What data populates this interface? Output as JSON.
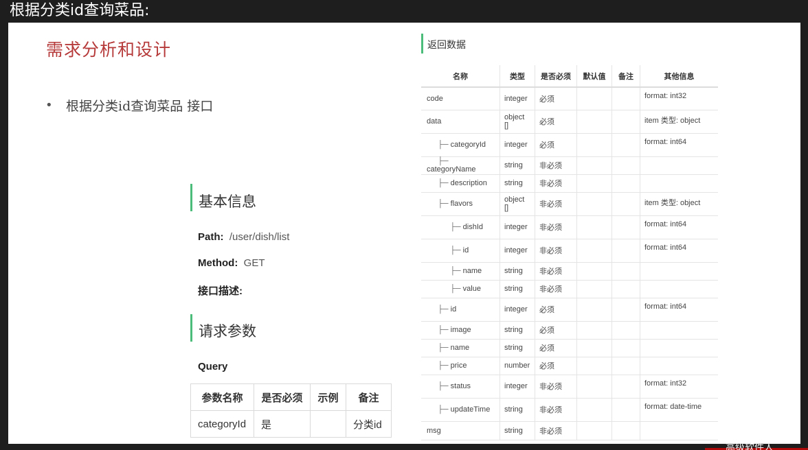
{
  "window": {
    "title": "根据分类id查询菜品:"
  },
  "bottom": {
    "text": "高级软件人"
  },
  "slide": {
    "heading": "需求分析和设计",
    "bullet": "根据分类id查询菜品 接口",
    "basic": {
      "title": "基本信息",
      "path_label": "Path:",
      "path_value": "/user/dish/list",
      "method_label": "Method:",
      "method_value": "GET",
      "desc_label": "接口描述:"
    },
    "request": {
      "title": "请求参数",
      "query_label": "Query",
      "headers": [
        "参数名称",
        "是否必须",
        "示例",
        "备注"
      ],
      "rows": [
        [
          "categoryId",
          "是",
          "",
          "分类id"
        ]
      ]
    },
    "response": {
      "title": "返回数据",
      "headers": [
        "名称",
        "类型",
        "是否必须",
        "默认值",
        "备注",
        "其他信息"
      ],
      "rows": [
        {
          "name": "code",
          "indent": 0,
          "type": "integer",
          "req": "必须",
          "def": "",
          "note": "",
          "other": "format: int32",
          "h": 33
        },
        {
          "name": "data",
          "indent": 0,
          "type": "object []",
          "req": "必须",
          "def": "",
          "note": "",
          "other": "item 类型: object",
          "h": 34
        },
        {
          "name": "categoryId",
          "indent": 1,
          "type": "integer",
          "req": "必须",
          "def": "",
          "note": "",
          "other": "format: int64",
          "h": 34
        },
        {
          "name": "categoryName",
          "indent": 1,
          "type": "string",
          "req": "非必须",
          "def": "",
          "note": "",
          "other": "",
          "h": 26
        },
        {
          "name": "description",
          "indent": 1,
          "type": "string",
          "req": "非必须",
          "def": "",
          "note": "",
          "other": "",
          "h": 26
        },
        {
          "name": "flavors",
          "indent": 1,
          "type": "object []",
          "req": "非必须",
          "def": "",
          "note": "",
          "other": "item 类型: object",
          "h": 34
        },
        {
          "name": "dishId",
          "indent": 2,
          "type": "integer",
          "req": "非必须",
          "def": "",
          "note": "",
          "other": "format: int64",
          "h": 34
        },
        {
          "name": "id",
          "indent": 2,
          "type": "integer",
          "req": "非必须",
          "def": "",
          "note": "",
          "other": "format: int64",
          "h": 34
        },
        {
          "name": "name",
          "indent": 2,
          "type": "string",
          "req": "非必须",
          "def": "",
          "note": "",
          "other": "",
          "h": 26
        },
        {
          "name": "value",
          "indent": 2,
          "type": "string",
          "req": "非必须",
          "def": "",
          "note": "",
          "other": "",
          "h": 26
        },
        {
          "name": "id",
          "indent": 1,
          "type": "integer",
          "req": "必须",
          "def": "",
          "note": "",
          "other": "format: int64",
          "h": 34
        },
        {
          "name": "image",
          "indent": 1,
          "type": "string",
          "req": "必须",
          "def": "",
          "note": "",
          "other": "",
          "h": 26
        },
        {
          "name": "name",
          "indent": 1,
          "type": "string",
          "req": "必须",
          "def": "",
          "note": "",
          "other": "",
          "h": 26
        },
        {
          "name": "price",
          "indent": 1,
          "type": "number",
          "req": "必须",
          "def": "",
          "note": "",
          "other": "",
          "h": 26
        },
        {
          "name": "status",
          "indent": 1,
          "type": "integer",
          "req": "非必须",
          "def": "",
          "note": "",
          "other": "format: int32",
          "h": 34
        },
        {
          "name": "updateTime",
          "indent": 1,
          "type": "string",
          "req": "非必须",
          "def": "",
          "note": "",
          "other": "format: date-time",
          "h": 34
        },
        {
          "name": "msg",
          "indent": 0,
          "type": "string",
          "req": "非必须",
          "def": "",
          "note": "",
          "other": "",
          "h": 27
        }
      ]
    }
  }
}
